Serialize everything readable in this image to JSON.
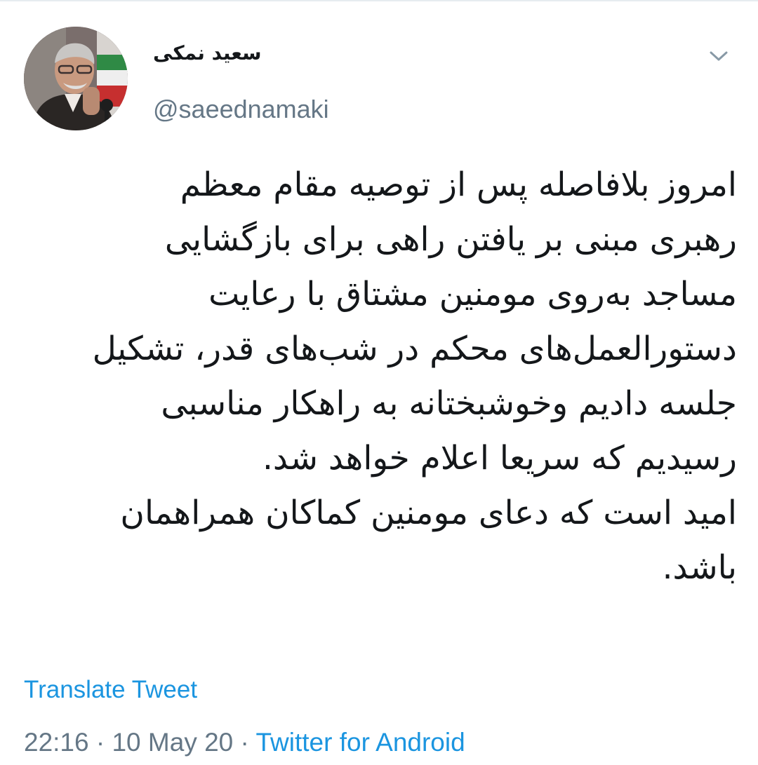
{
  "tweet": {
    "author": {
      "display_name": "سعید نمکی",
      "handle": "@saeednamaki"
    },
    "menu_icon": "chevron-down-icon",
    "body_lines": [
      "امروز بلافاصله پس از توصیه مقام معظم",
      "رهبری مبنی بر یافتن راهی برای بازگشایی",
      "مساجد به‌روی مومنین مشتاق با رعایت",
      "دستورالعمل‌های محکم در شب‌های قدر، تشکیل",
      "جلسه دادیم وخوشبختانه به راهکار مناسبی",
      "رسیدیم که سریعا اعلام خواهد شد.",
      "امید است که دعای مومنین کماکان همراهمان",
      "باشد."
    ],
    "translate_label": "Translate Tweet",
    "time": "22:16",
    "date": "10 May 20",
    "separator": "·",
    "source": "Twitter for Android"
  },
  "colors": {
    "text": "#14171a",
    "secondary": "#657786",
    "link": "#1b95e0",
    "divider": "#e6ecf0"
  }
}
